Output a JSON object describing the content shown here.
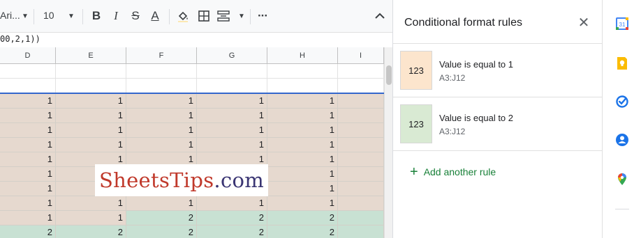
{
  "toolbar": {
    "font_name": "Ari...",
    "font_size": "10",
    "bold": "B",
    "italic": "I",
    "strike": "S",
    "text_color": "A",
    "more": "···",
    "collapse": "⌃"
  },
  "formula": "00,2,1))",
  "columns": [
    "D",
    "E",
    "F",
    "G",
    "H",
    "I"
  ],
  "rows": [
    {
      "values": [
        "1",
        "1",
        "1",
        "1",
        "1",
        ""
      ],
      "fill": "#e6d9cf"
    },
    {
      "values": [
        "1",
        "1",
        "1",
        "1",
        "1",
        ""
      ],
      "fill": "#e6d9cf"
    },
    {
      "values": [
        "1",
        "1",
        "1",
        "1",
        "1",
        ""
      ],
      "fill": "#e6d9cf"
    },
    {
      "values": [
        "1",
        "1",
        "1",
        "1",
        "1",
        ""
      ],
      "fill": "#e6d9cf"
    },
    {
      "values": [
        "1",
        "1",
        "1",
        "1",
        "1",
        ""
      ],
      "fill": "#e6d9cf"
    },
    {
      "values": [
        "1",
        "1",
        "1",
        "1",
        "1",
        ""
      ],
      "fill": "#e6d9cf"
    },
    {
      "values": [
        "1",
        "1",
        "1",
        "1",
        "1",
        ""
      ],
      "fill": "#e6d9cf"
    },
    {
      "values": [
        "1",
        "1",
        "1",
        "1",
        "1",
        ""
      ],
      "fill": "#e6d9cf"
    },
    {
      "values": [
        "1",
        "1",
        "2",
        "2",
        "2",
        ""
      ],
      "fill_pattern": [
        "#e6d9cf",
        "#e6d9cf",
        "#c8e1d3",
        "#c8e1d3",
        "#c8e1d3",
        "#c8e1d3"
      ]
    },
    {
      "values": [
        "2",
        "2",
        "2",
        "2",
        "2",
        ""
      ],
      "fill": "#c8e1d3"
    }
  ],
  "watermark": {
    "part1": "SheetsTips",
    "part2": ".com"
  },
  "panel": {
    "title": "Conditional format rules",
    "close": "✕",
    "rules": [
      {
        "preview": "123",
        "title": "Value is equal to 1",
        "range": "A3:J12",
        "color": "#fce5cd"
      },
      {
        "preview": "123",
        "title": "Value is equal to 2",
        "range": "A3:J12",
        "color": "#d9ead3"
      }
    ],
    "add_rule": "Add another rule",
    "add_icon": "+"
  },
  "rail": {
    "icons": [
      "calendar-icon",
      "keep-icon",
      "tasks-icon",
      "contacts-icon",
      "maps-icon"
    ],
    "calendar_label": "31"
  }
}
